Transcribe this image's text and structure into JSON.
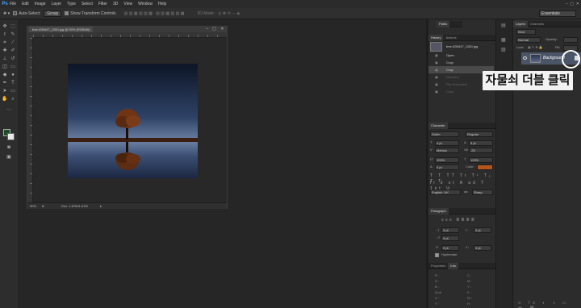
{
  "app": {
    "logo": "Ps"
  },
  "menu": [
    "File",
    "Edit",
    "Image",
    "Layer",
    "Type",
    "Select",
    "Filter",
    "3D",
    "View",
    "Window",
    "Help"
  ],
  "options": {
    "auto_select_label": "Auto-Select:",
    "auto_select_value": "Group",
    "transform_label": "Show Transform Controls",
    "mode_3d_label": "3D Mode:",
    "workspace": "Essentials"
  },
  "document": {
    "tab_title": "tree-839447_1280.jpg @ 50% (RGB/8#)",
    "zoom": "50%",
    "doc_info": "Doc: 1.87M/1.87M"
  },
  "panels": {
    "paths_tab": "Paths",
    "history": {
      "tabs": [
        "History",
        "Actions"
      ],
      "snapshot": "tree-839447_1280.jpg",
      "items": [
        {
          "label": "Open",
          "state": "normal"
        },
        {
          "label": "Crop",
          "state": "normal"
        },
        {
          "label": "Crop",
          "state": "selected"
        },
        {
          "label": "Deselect",
          "state": "dim"
        },
        {
          "label": "Flip Horizontal",
          "state": "dim"
        },
        {
          "label": "Crop",
          "state": "dim"
        }
      ]
    },
    "character": {
      "tab": "Character",
      "font_family": "Gulim",
      "font_style": "Regular",
      "font_size": "4 pt",
      "leading": "5 pt",
      "kerning": "Metrics",
      "tracking": "-25",
      "vertical_scale": "100%",
      "horizontal_scale": "100%",
      "baseline_shift": "0 pt",
      "color_label": "Color:",
      "color_value": "#b4561a",
      "language": "English: UK",
      "antialias": "Sharp"
    },
    "paragraph": {
      "tab": "Paragraph",
      "indent_left": "0 pt",
      "indent_right": "0 pt",
      "indent_first": "0 pt",
      "space_before": "0 pt",
      "space_after": "0 pt",
      "hyphenate_label": "Hyphenate"
    },
    "info": {
      "tabs": [
        "Properties",
        "Info"
      ]
    },
    "layers": {
      "tabs": [
        "Layers",
        "Channels"
      ],
      "kind_label": "Kind",
      "mode": "Normal",
      "opacity_label": "Opacity:",
      "lock_label": "Lock:",
      "fill_label": "Fill:",
      "layer_name": "Background"
    }
  },
  "callout": "자물쇠 더블 클릭",
  "colors": {
    "accent": "#4aa3ff",
    "layer_selected": "#4b5568",
    "foreground": "#1f4d2a",
    "background_swatch": "#e8e8e8"
  }
}
